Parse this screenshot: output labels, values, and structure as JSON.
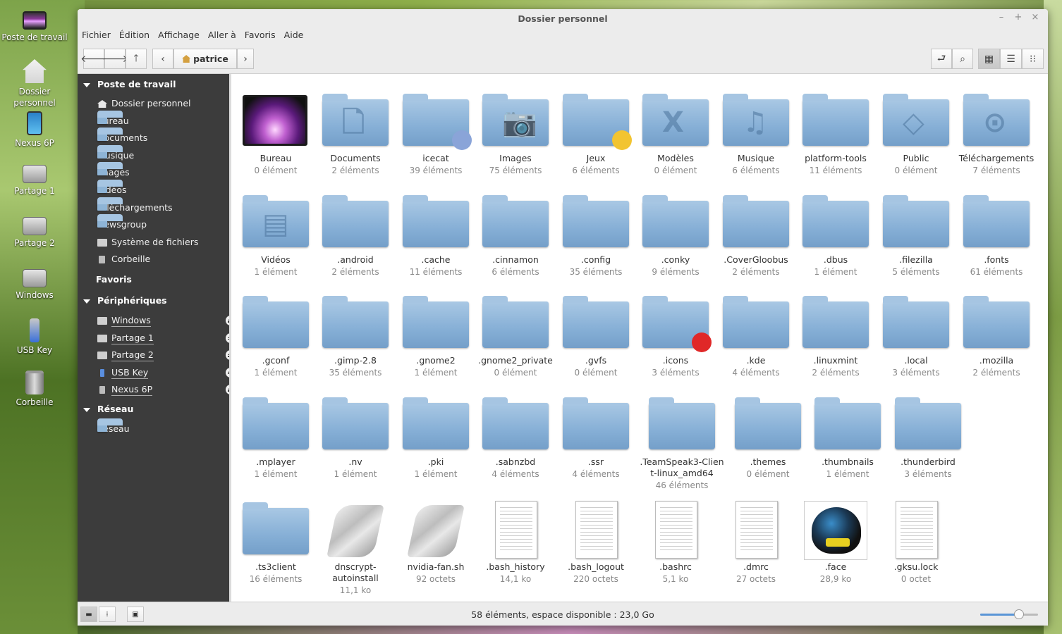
{
  "desktop": {
    "icons": [
      {
        "label": "Poste de travail",
        "type": "monitor"
      },
      {
        "label": "Dossier personnel",
        "type": "home"
      },
      {
        "label": "Nexus 6P",
        "type": "phone"
      },
      {
        "label": "Partage 1",
        "type": "drive"
      },
      {
        "label": "Partage 2",
        "type": "drive"
      },
      {
        "label": "Windows",
        "type": "drive"
      },
      {
        "label": "USB Key",
        "type": "usb"
      },
      {
        "label": "Corbeille",
        "type": "trash"
      }
    ]
  },
  "window": {
    "title": "Dossier personnel",
    "controls": {
      "minimize": "–",
      "maximize": "+",
      "close": "×"
    }
  },
  "menubar": [
    "Fichier",
    "Édition",
    "Affichage",
    "Aller à",
    "Favoris",
    "Aide"
  ],
  "toolbar": {
    "back": "🡐",
    "forward": "🡒",
    "up": "🡑",
    "crumb_prev": "‹",
    "crumb_next": "›",
    "breadcrumb": "patrice",
    "terminal": "⮐",
    "search": "⌕",
    "view_icons": "▦",
    "view_list": "☰",
    "view_compact": "⁝⁝"
  },
  "sidebar": {
    "sections": {
      "computer": "Poste de travail",
      "favorites": "Favoris",
      "devices": "Périphériques",
      "network": "Réseau"
    },
    "computer_items": [
      {
        "label": "Dossier personnel",
        "icon": "home"
      },
      {
        "label": "Bureau",
        "icon": "folder"
      },
      {
        "label": "Documents",
        "icon": "folder"
      },
      {
        "label": "Musique",
        "icon": "folder"
      },
      {
        "label": "Images",
        "icon": "folder"
      },
      {
        "label": "Vidéos",
        "icon": "folder"
      },
      {
        "label": "Téléchargements",
        "icon": "folder"
      },
      {
        "label": "Newsgroup",
        "icon": "folder"
      },
      {
        "label": "Système de fichiers",
        "icon": "drive"
      },
      {
        "label": "Corbeille",
        "icon": "trash"
      }
    ],
    "device_items": [
      {
        "label": "Windows",
        "icon": "drive"
      },
      {
        "label": "Partage 1",
        "icon": "drive"
      },
      {
        "label": "Partage 2",
        "icon": "drive"
      },
      {
        "label": "USB Key",
        "icon": "usb"
      },
      {
        "label": "Nexus 6P",
        "icon": "phone"
      }
    ],
    "network_items": [
      {
        "label": "Réseau",
        "icon": "folder"
      }
    ]
  },
  "files": [
    {
      "name": "Bureau",
      "count": "0 élément",
      "kind": "screen"
    },
    {
      "name": "Documents",
      "count": "2 éléments",
      "kind": "folder",
      "glyph": "🗋"
    },
    {
      "name": "icecat",
      "count": "39 éléments",
      "kind": "folder",
      "emblem": "#8aa4d8"
    },
    {
      "name": "Images",
      "count": "75 éléments",
      "kind": "folder",
      "glyph": "📷"
    },
    {
      "name": "Jeux",
      "count": "6 éléments",
      "kind": "folder",
      "emblem": "#f2c431"
    },
    {
      "name": "Modèles",
      "count": "0 élément",
      "kind": "folder",
      "glyph": "X"
    },
    {
      "name": "Musique",
      "count": "6 éléments",
      "kind": "folder",
      "glyph": "♫"
    },
    {
      "name": "platform-tools",
      "count": "11 éléments",
      "kind": "folder"
    },
    {
      "name": "Public",
      "count": "0 élément",
      "kind": "folder",
      "glyph": "◇"
    },
    {
      "name": "Téléchargements",
      "count": "7 éléments",
      "kind": "folder",
      "glyph": "⊙"
    },
    {
      "name": "Vidéos",
      "count": "1 élément",
      "kind": "folder",
      "glyph": "▤"
    },
    {
      "name": ".android",
      "count": "2 éléments",
      "kind": "folder"
    },
    {
      "name": ".cache",
      "count": "11 éléments",
      "kind": "folder"
    },
    {
      "name": ".cinnamon",
      "count": "6 éléments",
      "kind": "folder"
    },
    {
      "name": ".config",
      "count": "35 éléments",
      "kind": "folder"
    },
    {
      "name": ".conky",
      "count": "9 éléments",
      "kind": "folder"
    },
    {
      "name": ".CoverGloobus",
      "count": "2 éléments",
      "kind": "folder"
    },
    {
      "name": ".dbus",
      "count": "1 élément",
      "kind": "folder"
    },
    {
      "name": ".filezilla",
      "count": "5 éléments",
      "kind": "folder"
    },
    {
      "name": ".fonts",
      "count": "61 éléments",
      "kind": "folder"
    },
    {
      "name": ".gconf",
      "count": "1 élément",
      "kind": "folder"
    },
    {
      "name": ".gimp-2.8",
      "count": "35 éléments",
      "kind": "folder"
    },
    {
      "name": ".gnome2",
      "count": "1 élément",
      "kind": "folder"
    },
    {
      "name": ".gnome2_private",
      "count": "0 élément",
      "kind": "folder"
    },
    {
      "name": ".gvfs",
      "count": "0 élément",
      "kind": "folder"
    },
    {
      "name": ".icons",
      "count": "3 éléments",
      "kind": "folder",
      "emblem": "#e02828"
    },
    {
      "name": ".kde",
      "count": "4 éléments",
      "kind": "folder"
    },
    {
      "name": ".linuxmint",
      "count": "2 éléments",
      "kind": "folder"
    },
    {
      "name": ".local",
      "count": "3 éléments",
      "kind": "folder"
    },
    {
      "name": ".mozilla",
      "count": "2 éléments",
      "kind": "folder"
    },
    {
      "name": ".mplayer",
      "count": "1 élément",
      "kind": "folder"
    },
    {
      "name": ".nv",
      "count": "1 élément",
      "kind": "folder"
    },
    {
      "name": ".pki",
      "count": "1 élément",
      "kind": "folder"
    },
    {
      "name": ".sabnzbd",
      "count": "4 éléments",
      "kind": "folder"
    },
    {
      "name": ".ssr",
      "count": "4 éléments",
      "kind": "folder"
    },
    {
      "name": ".TeamSpeak3-Client-linux_amd64",
      "count": "46 éléments",
      "kind": "folder"
    },
    {
      "name": ".themes",
      "count": "0 élément",
      "kind": "folder"
    },
    {
      "name": ".thumbnails",
      "count": "1 élément",
      "kind": "folder"
    },
    {
      "name": ".thunderbird",
      "count": "3 éléments",
      "kind": "folder"
    },
    {
      "name": ".ts3client",
      "count": "16 éléments",
      "kind": "folder"
    },
    {
      "name": "dnscrypt-autoinstall",
      "count": "11,1 ko",
      "kind": "script"
    },
    {
      "name": "nvidia-fan.sh",
      "count": "92 octets",
      "kind": "script"
    },
    {
      "name": ".bash_history",
      "count": "14,1 ko",
      "kind": "doc"
    },
    {
      "name": ".bash_logout",
      "count": "220 octets",
      "kind": "doc"
    },
    {
      "name": ".bashrc",
      "count": "5,1 ko",
      "kind": "doc"
    },
    {
      "name": ".dmrc",
      "count": "27 octets",
      "kind": "doc"
    },
    {
      "name": ".face",
      "count": "28,9 ko",
      "kind": "helmet"
    },
    {
      "name": ".gksu.lock",
      "count": "0 octet",
      "kind": "doc"
    }
  ],
  "statusbar": {
    "text": "58 éléments, espace disponible : 23,0 Go",
    "toggle_places": "▬",
    "toggle_tree": "⁞",
    "toggle_pane": "▣",
    "zoom_fraction": 0.67
  }
}
